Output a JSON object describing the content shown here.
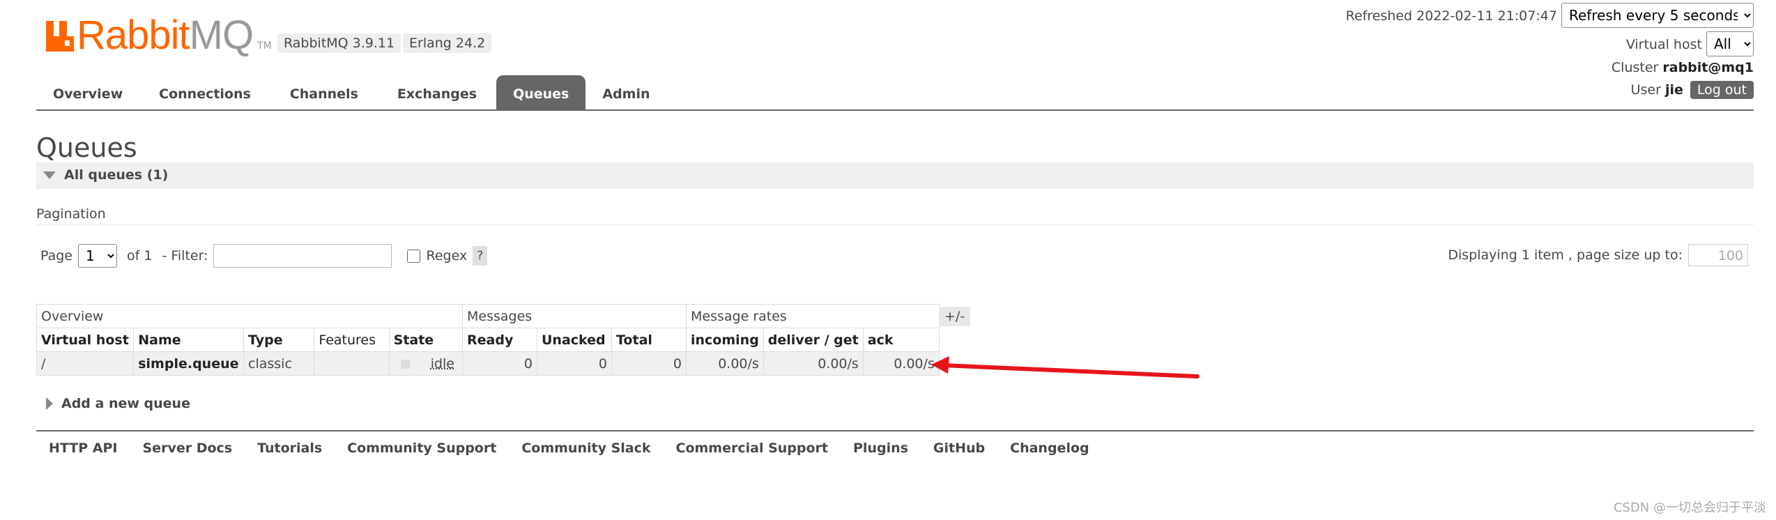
{
  "header": {
    "logo_text_rabbit": "Rabbit",
    "logo_text_mq": "MQ",
    "logo_tm": "TM",
    "rabbitmq_version": "RabbitMQ 3.9.11",
    "erlang_version": "Erlang 24.2",
    "refreshed_label": "Refreshed 2022-02-11 21:07:47",
    "refresh_select": "Refresh every 5 seconds",
    "vhost_label": "Virtual host",
    "vhost_select": "All",
    "cluster_label": "Cluster",
    "cluster_name": "rabbit@mq1",
    "user_label": "User",
    "user_name": "jie",
    "logout_label": "Log out"
  },
  "nav": {
    "tabs": [
      {
        "label": "Overview"
      },
      {
        "label": "Connections"
      },
      {
        "label": "Channels"
      },
      {
        "label": "Exchanges"
      },
      {
        "label": "Queues",
        "active": true
      },
      {
        "label": "Admin"
      }
    ]
  },
  "main": {
    "title": "Queues",
    "section_title": "All queues (1)",
    "pagination_label": "Pagination",
    "page_label": "Page",
    "page_select": "1",
    "of_label": "of 1",
    "filter_label": "- Filter:",
    "regex_label": "Regex",
    "help_label": "?",
    "displaying_label": "Displaying 1 item , page size up to:",
    "page_size": "100",
    "plus_minus": "+/-",
    "add_queue_label": "Add a new queue"
  },
  "table": {
    "groups": [
      "Overview",
      "Messages",
      "Message rates"
    ],
    "columns": [
      "Virtual host",
      "Name",
      "Type",
      "Features",
      "State",
      "Ready",
      "Unacked",
      "Total",
      "incoming",
      "deliver / get",
      "ack"
    ],
    "row": {
      "vhost": "/",
      "name": "simple.queue",
      "type": "classic",
      "features": "",
      "state": "idle",
      "ready": "0",
      "unacked": "0",
      "total": "0",
      "incoming": "0.00/s",
      "deliver_get": "0.00/s",
      "ack": "0.00/s"
    }
  },
  "footer": {
    "links": [
      "HTTP API",
      "Server Docs",
      "Tutorials",
      "Community Support",
      "Community Slack",
      "Commercial Support",
      "Plugins",
      "GitHub",
      "Changelog"
    ]
  },
  "watermark": "CSDN @一切总会归于平淡",
  "colors": {
    "brand": "#ff6600",
    "tab_active": "#666666",
    "arrow": "#e8141c"
  }
}
